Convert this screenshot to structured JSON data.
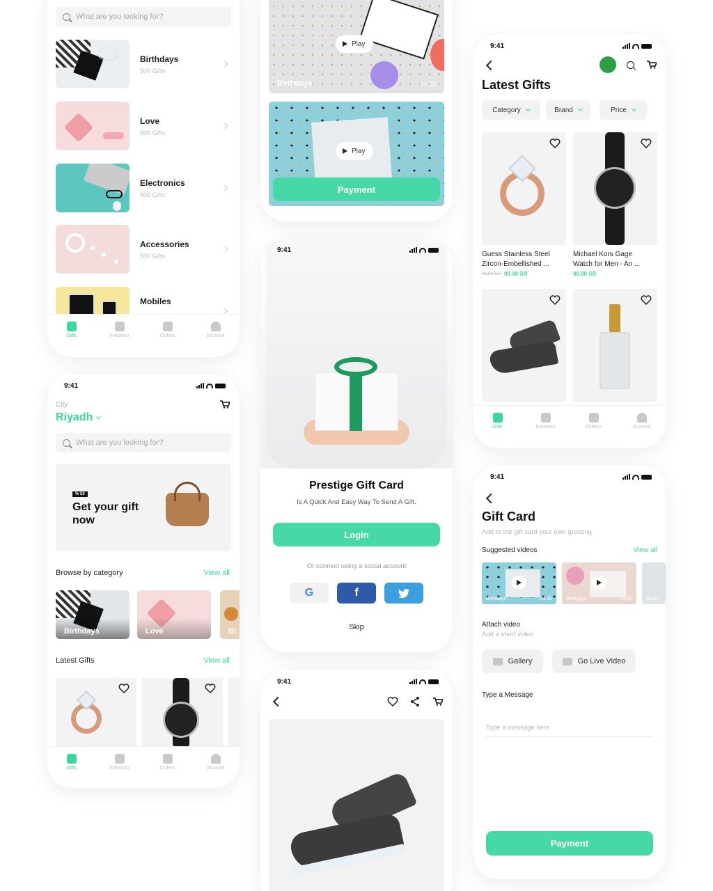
{
  "colors": {
    "accent": "#46d9a5",
    "facebook": "#2d5ba9",
    "twitter": "#3c9fe0"
  },
  "status_time": "9:41",
  "categories_screen": {
    "search_placeholder": "What are you looking for?",
    "categories": [
      {
        "title": "Birthdays",
        "count": "500 Gifts"
      },
      {
        "title": "Love",
        "count": "500 Gifts"
      },
      {
        "title": "Electronics",
        "count": "500 Gifts"
      },
      {
        "title": "Accessories",
        "count": "500 Gifts"
      },
      {
        "title": "Mobiles",
        "count": ""
      }
    ]
  },
  "tabs": [
    "Gifts",
    "Invitation",
    "Orders",
    "Account"
  ],
  "home_screen": {
    "city_label": "City",
    "city": "Riyadh",
    "search_placeholder": "What are you looking for?",
    "banner_badge": "% 50",
    "banner_text_line1": "Get your gift",
    "banner_text_line2": "now",
    "browse_title": "Browse by category",
    "browse_view_all": "View all",
    "browse_items": [
      "Birthdays",
      "Love",
      "Bi"
    ],
    "latest_title": "Latest Gifts",
    "latest_view_all": "View all"
  },
  "video_screen": {
    "play_label": "Play",
    "video1_label": "Birthdays",
    "video1_time": "01:30",
    "payment_label": "Payment"
  },
  "login_screen": {
    "title": "Prestige Gift Card",
    "subtitle": "Is A Quick And Easy Way To Send A Gift.",
    "login_label": "Login",
    "connect_text": "Or connect using a social account",
    "skip_label": "Skip"
  },
  "latest_screen": {
    "title": "Latest Gifts",
    "filters": [
      "Category",
      "Brand",
      "Price"
    ],
    "products": [
      {
        "name_line1": "Guess Stainless Steel",
        "name_line2": "Zircon-Embellished ...",
        "old_price": "00.00 SR",
        "price": "00.00 SR"
      },
      {
        "name_line1": "Michael Kors Gage",
        "name_line2": "Watch for Men - An ...",
        "old_price": "",
        "price": "00.00 SR"
      }
    ]
  },
  "giftcard_screen": {
    "title": "Gift Card",
    "subtitle": "Add to the gift card your own greeting",
    "suggested_title": "Suggested videos",
    "view_all": "View all",
    "videos": [
      {
        "label": "Birthdays",
        "time": "01:30"
      },
      {
        "label": "Birthdays",
        "time": "01:30"
      },
      {
        "label": "Birtha",
        "time": ""
      }
    ],
    "attach_title": "Attach video",
    "attach_sub": "Add a short video",
    "gallery_label": "Gallery",
    "live_label": "Go Live Video",
    "message_title": "Type a Message",
    "message_placeholder": "Type a message here",
    "payment_label": "Payment"
  }
}
